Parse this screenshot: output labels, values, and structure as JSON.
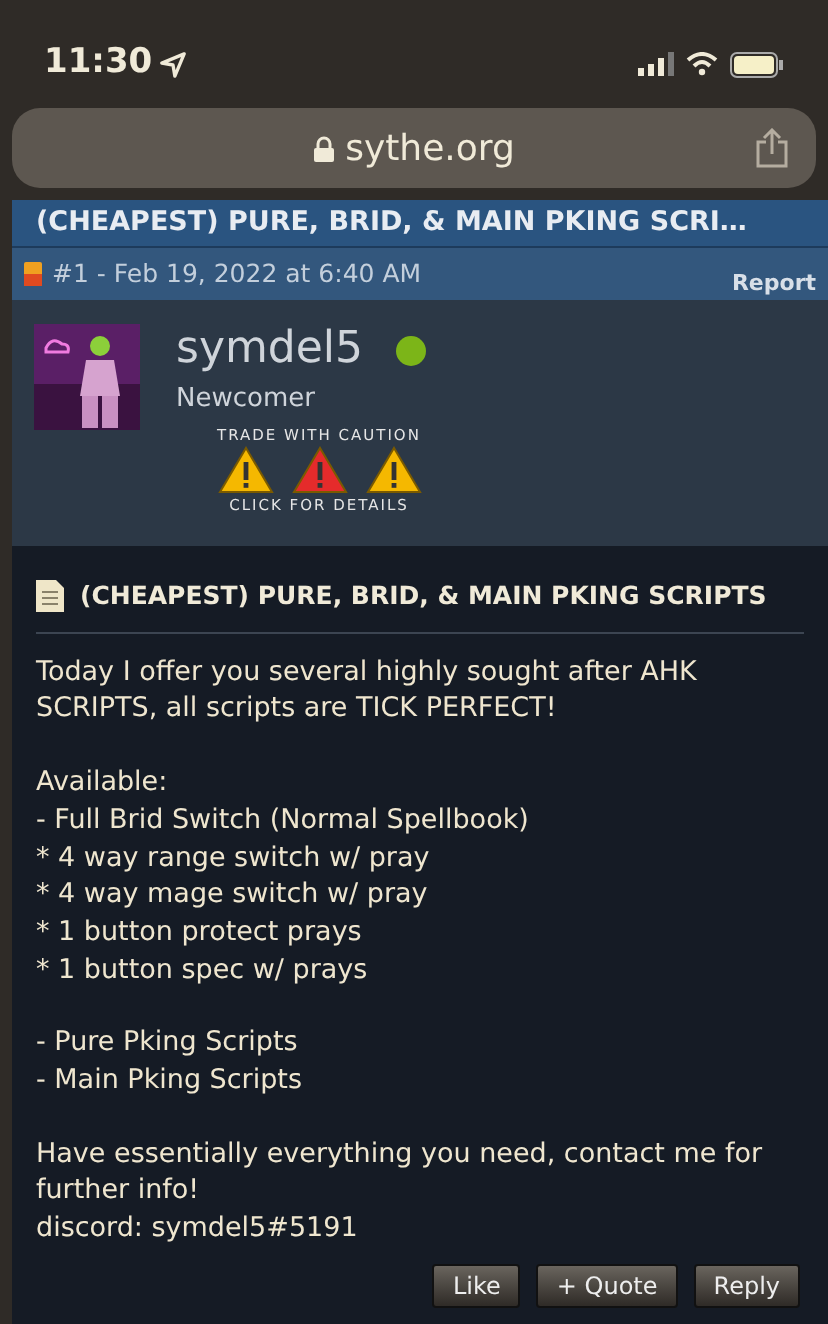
{
  "status_bar": {
    "time": "11:30"
  },
  "address_bar": {
    "domain": "sythe.org"
  },
  "thread": {
    "title": "(CHEAPEST) PURE, BRID, & MAIN PKING SCRI…"
  },
  "post_header": {
    "meta": "#1 - Feb 19, 2022 at 6:40 AM",
    "report": "Report"
  },
  "user": {
    "name": "symdel5",
    "online": true,
    "rank": "Newcomer",
    "warning_top": "TRADE WITH CAUTION",
    "warning_bottom": "CLICK FOR DETAILS",
    "warnings": [
      {
        "color": "#f5b800"
      },
      {
        "color": "#e52b2b"
      },
      {
        "color": "#f5b800"
      }
    ]
  },
  "post": {
    "title": "(CHEAPEST) PURE, BRID, & MAIN PKING SCRIPTS",
    "paragraphs": [
      {
        "lines": [
          "Today I offer you several highly sought after AHK SCRIPTS, all scripts are TICK PERFECT!"
        ]
      },
      {
        "lines": [
          "Available:",
          "- Full Brid Switch (Normal Spellbook)",
          "* 4 way range switch w/ pray",
          "* 4 way mage switch w/ pray",
          "* 1 button protect prays",
          "* 1 button spec w/ prays"
        ]
      },
      {
        "lines": [
          "- Pure Pking Scripts",
          "- Main Pking Scripts"
        ]
      },
      {
        "lines": [
          "Have essentially everything you need, contact me for further info!",
          "discord: symdel5#5191"
        ]
      }
    ],
    "buttons": [
      "Like",
      "+ Quote",
      "Reply"
    ]
  }
}
